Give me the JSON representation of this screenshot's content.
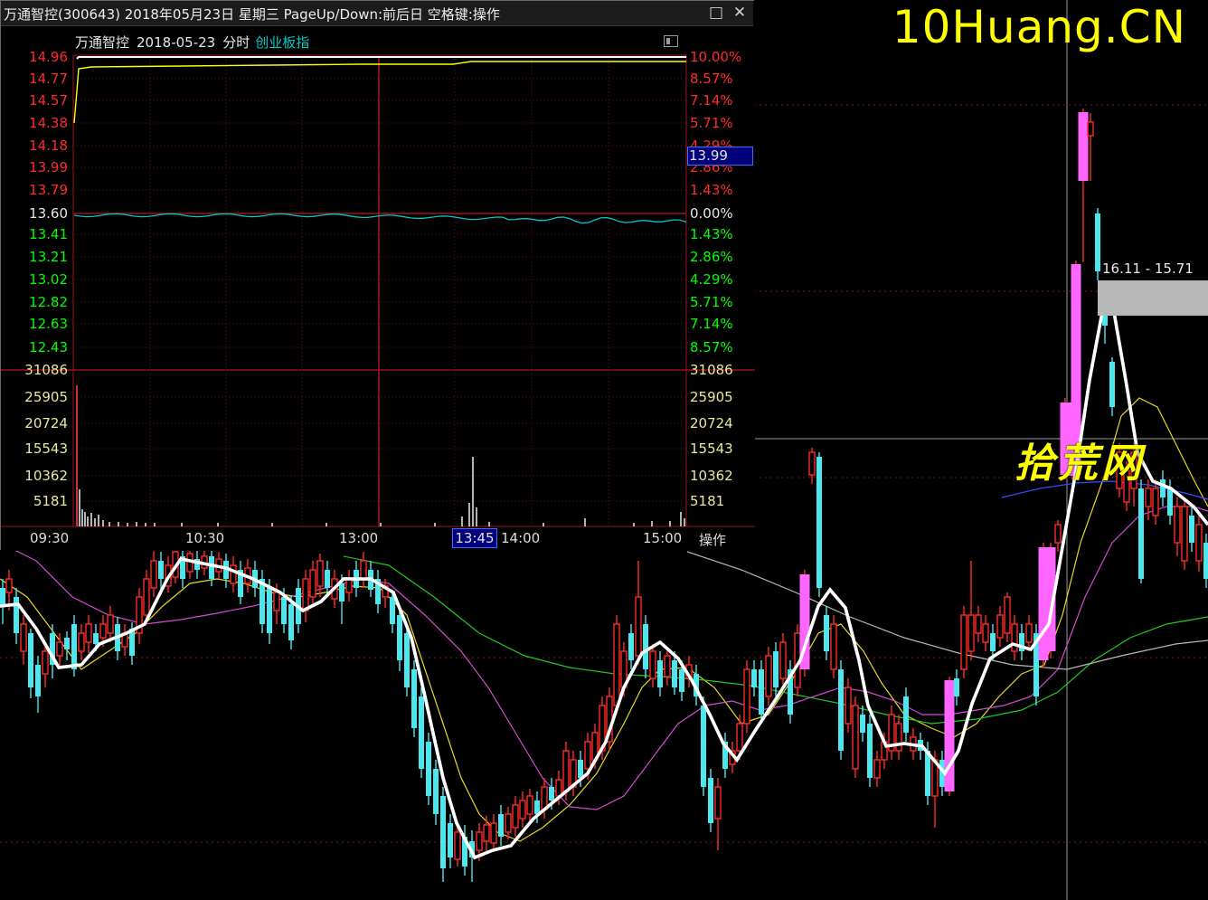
{
  "window": {
    "title": "万通智控(300643) 2018年05月23日 星期三 PageUp/Down:前后日 空格键:操作",
    "restore_icon": "□",
    "close_icon": "✕"
  },
  "header": {
    "stock_name": "万通智控",
    "date": "2018-05-23",
    "mode": "分时",
    "index_link": "创业板指"
  },
  "watermark": "10Huang.CN",
  "stamp": "拾荒网",
  "price_range_label": "16.11 - 15.71",
  "price_axis": [
    "14.96",
    "14.77",
    "14.57",
    "14.38",
    "14.18",
    "13.99",
    "13.79",
    "13.60",
    "13.41",
    "13.21",
    "13.02",
    "12.82",
    "12.63",
    "12.43"
  ],
  "pct_axis": [
    "10.00%",
    "8.57%",
    "7.14%",
    "5.71%",
    "4.29%",
    "2.86%",
    "1.43%",
    "0.00%",
    "1.43%",
    "2.86%",
    "4.29%",
    "5.71%",
    "7.14%",
    "8.57%"
  ],
  "volume_axis": [
    "31086",
    "25905",
    "20724",
    "15543",
    "10362",
    "5181"
  ],
  "time_axis": [
    "09:30",
    "10:30",
    "13:00",
    "14:00",
    "15:00"
  ],
  "cursor": {
    "price": "13.99",
    "time": "13:45"
  },
  "operate_button": "操作",
  "colors": {
    "up": "#ff2a2a",
    "down": "#00ff00",
    "flat": "#e6e6e6",
    "axis_label_vol": "#e8e8a0",
    "index_line": "#00c8c8",
    "price_line": "#ffff00",
    "candle_up": "#ff2a2a",
    "candle_down": "#4ae8ee",
    "limit_up": "#ff66ff"
  }
}
